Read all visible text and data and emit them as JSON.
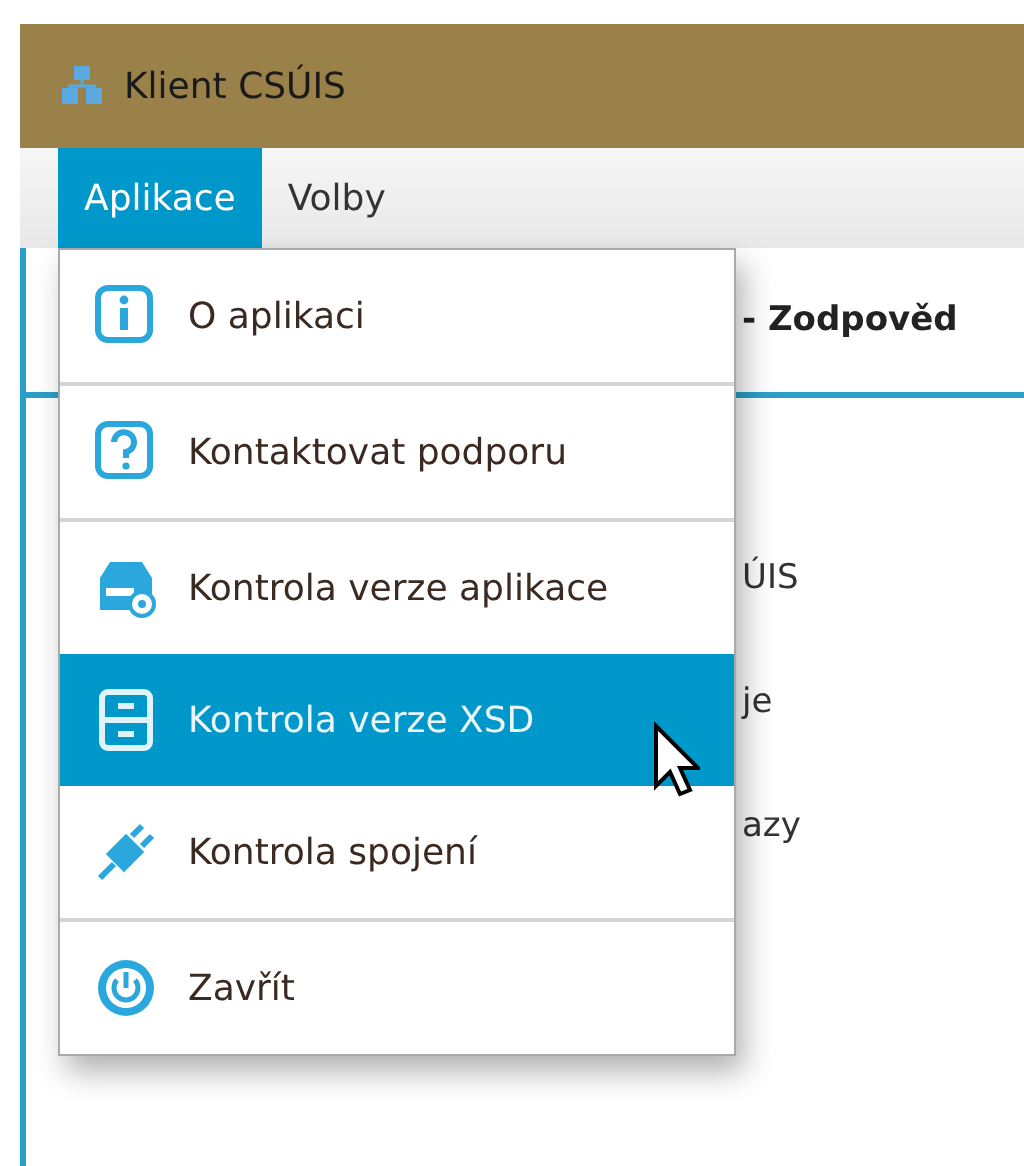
{
  "window": {
    "title": "Klient CSÚIS"
  },
  "menubar": [
    {
      "label": "Aplikace",
      "selected": true
    },
    {
      "label": "Volby",
      "selected": false
    }
  ],
  "content": {
    "heading": "- Zodpověd",
    "lines": [
      "ÚIS",
      "je",
      "azy"
    ]
  },
  "menu": {
    "groups": [
      [
        {
          "label": "O aplikaci",
          "kind": "info",
          "selected": false
        }
      ],
      [
        {
          "label": "Kontaktovat podporu",
          "kind": "help",
          "selected": false
        }
      ],
      [
        {
          "label": "Kontrola verze aplikace",
          "kind": "disk",
          "selected": false
        },
        {
          "label": "Kontrola verze XSD",
          "kind": "cabinet",
          "selected": true
        },
        {
          "label": "Kontrola spojení",
          "kind": "plug",
          "selected": false
        }
      ],
      [
        {
          "label": "Zavřít",
          "kind": "power",
          "selected": false
        }
      ]
    ]
  }
}
